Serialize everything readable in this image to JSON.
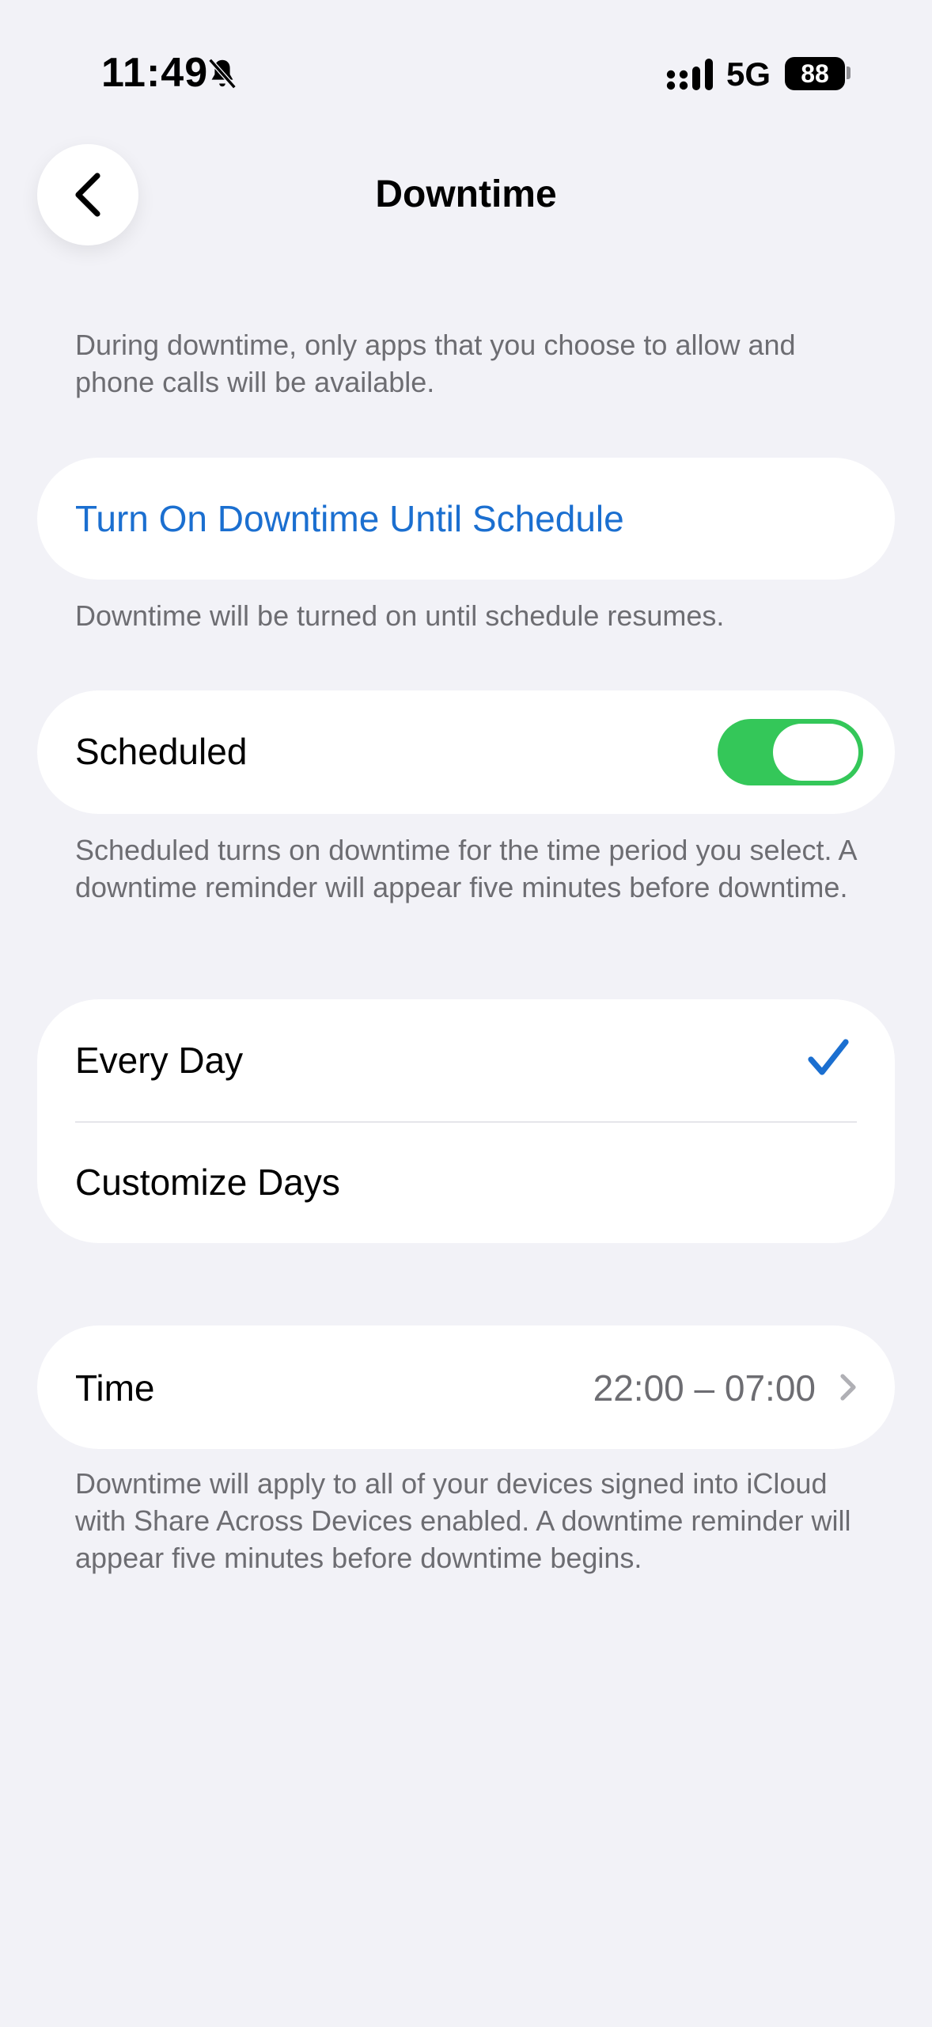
{
  "status_bar": {
    "time": "11:49",
    "network": "5G",
    "battery": "88",
    "icons": [
      "bell-slash-icon",
      "signal-icon"
    ]
  },
  "nav": {
    "title": "Downtime",
    "back_icon": "chevron-left-icon"
  },
  "intro_text": "During downtime, only apps that you choose to allow and phone calls will be available.",
  "turn_on": {
    "label": "Turn On Downtime Until Schedule",
    "footnote": "Downtime will be turned on until schedule resumes."
  },
  "scheduled": {
    "label": "Scheduled",
    "enabled": true,
    "footnote": "Scheduled turns on downtime for the time period you select. A downtime reminder will appear five minutes before downtime."
  },
  "days": {
    "options": [
      {
        "label": "Every Day",
        "selected": true
      },
      {
        "label": "Customize Days",
        "selected": false
      }
    ]
  },
  "time": {
    "label": "Time",
    "value": "22:00 – 07:00",
    "footnote": "Downtime will apply to all of your devices signed into iCloud with Share Across Devices enabled. A downtime reminder will appear five minutes before downtime begins."
  },
  "colors": {
    "accent": "#1b6fd0",
    "toggle_on": "#34c759",
    "background": "#f2f2f7"
  }
}
